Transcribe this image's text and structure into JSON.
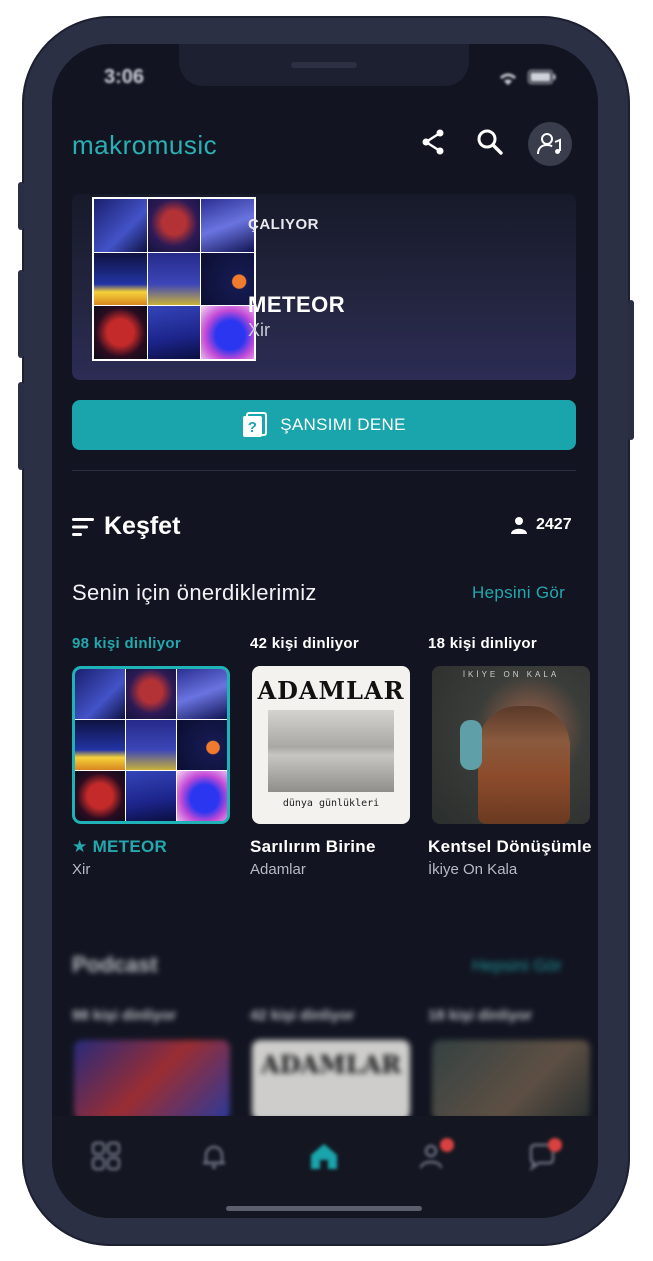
{
  "status": {
    "time": "3:06"
  },
  "header": {
    "logo": "makromusic",
    "icons": [
      "share-icon",
      "search-icon",
      "profile-music-icon"
    ]
  },
  "now_playing": {
    "label": "ÇALIYOR",
    "title": "METEOR",
    "artist": "Xir"
  },
  "try_button": {
    "label": "ŞANSIMI DENE",
    "icon": "question-card-icon"
  },
  "discover": {
    "title": "Keşfet",
    "user_count": "2427"
  },
  "recommended": {
    "title": "Senin için önerdiklerimiz",
    "see_all": "Hepsini Gör",
    "items": [
      {
        "listeners": "98 kişi dinliyor",
        "title": "METEOR",
        "artist": "Xir",
        "star": "★"
      },
      {
        "listeners": "42 kişi dinliyor",
        "title": "Sarılırım Birine",
        "artist": "Adamlar",
        "cover_title": "ADAMLAR",
        "cover_sub": "dünya günlükleri"
      },
      {
        "listeners": "18 kişi dinliyor",
        "title": "Kentsel Dönüşümle",
        "artist": "İkiye On Kala",
        "cover_title": "İKİYE ON KALA"
      }
    ]
  },
  "podcast": {
    "title": "Podcast",
    "see_all": "Hepsini Gör",
    "items": [
      {
        "listeners": "98 kişi dinliyor"
      },
      {
        "listeners": "42 kişi dinliyor",
        "cover_title": "ADAMLAR"
      },
      {
        "listeners": "18 kişi dinliyor"
      }
    ]
  },
  "tabbar": {
    "tabs": [
      "grid-icon",
      "bell-icon",
      "home-icon",
      "friends-icon",
      "chat-icon"
    ],
    "active": "home-icon",
    "colors": {
      "accent": "#1aa4ab",
      "badge": "#d94141"
    }
  }
}
